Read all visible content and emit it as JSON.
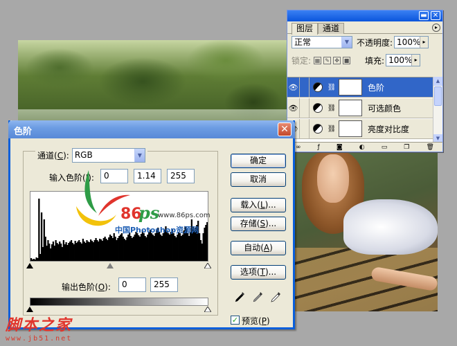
{
  "layers_panel": {
    "tabs": [
      "图层",
      "通道"
    ],
    "blend_mode": "正常",
    "opacity_label": "不透明度:",
    "opacity_value": "100%",
    "lock_label": "锁定:",
    "fill_label": "填充:",
    "fill_value": "100%",
    "layers": [
      {
        "name": "色阶",
        "selected": true
      },
      {
        "name": "可选颜色",
        "selected": false
      },
      {
        "name": "亮度对比度",
        "selected": false
      }
    ]
  },
  "levels_dialog": {
    "title": "色阶",
    "channel_label": "通道(",
    "channel_key": "C",
    "channel_label_end": "):",
    "channel_value": "RGB",
    "input_label": "输入色阶(",
    "input_key": "I",
    "input_label_end": "):",
    "input_values": [
      "0",
      "1.14",
      "255"
    ],
    "output_label": "输出色阶(",
    "output_key": "O",
    "output_label_end": "):",
    "output_values": [
      "0",
      "255"
    ],
    "buttons": {
      "ok": "确定",
      "cancel": "取消",
      "load": "载入(",
      "load_key": "L",
      "load_end": ")...",
      "save": "存储(",
      "save_key": "S",
      "save_end": ")...",
      "auto": "自动(",
      "auto_key": "A",
      "auto_end": ")",
      "options": "选项(",
      "options_key": "T",
      "options_end": ")..."
    },
    "preview_label": "预览(",
    "preview_key": "P",
    "preview_end": ")",
    "preview_checked": true,
    "histogram": [
      4,
      2,
      3,
      2,
      5,
      4,
      90,
      10,
      70,
      20,
      60,
      35,
      22,
      30,
      25,
      18,
      24,
      28,
      22,
      30,
      26,
      24,
      28,
      25,
      20,
      30,
      24,
      27,
      23,
      26,
      28,
      30,
      26,
      24,
      29,
      26,
      28,
      30,
      27,
      25,
      32,
      28,
      26,
      30,
      28,
      27,
      31,
      29,
      27,
      30,
      33,
      30,
      28,
      32,
      31,
      29,
      33,
      35,
      32,
      30,
      34,
      38,
      36,
      33,
      40,
      35,
      30,
      33,
      36,
      38,
      40,
      35,
      32,
      30,
      34,
      38,
      41,
      36,
      33,
      35,
      38,
      42,
      40,
      37,
      35,
      39,
      44,
      40,
      36,
      34,
      38,
      42,
      45,
      40,
      38,
      36,
      40,
      44,
      48,
      42,
      38,
      36,
      40,
      45,
      50,
      44,
      40,
      38,
      42,
      46,
      40,
      36,
      34,
      38,
      42,
      40,
      36,
      38,
      44,
      50,
      46,
      40,
      36,
      42,
      60,
      50,
      44,
      48,
      52,
      58,
      40,
      30,
      25,
      40,
      48,
      52,
      56
    ]
  },
  "watermarks": {
    "logo_number": "86",
    "logo_ps": "ps",
    "logo_url": "www.86ps.com",
    "logo_caption": "中国Photoshop资源网",
    "site_name": "脚本之家",
    "site_url": "www.jb51.net"
  },
  "colors": {
    "xp_blue": "#0a5fdb",
    "selected_layer": "#3166c8",
    "watermark_red": "#e0342c",
    "watermark_green": "#2e9c46",
    "watermark_yellow": "#f2c20b"
  }
}
